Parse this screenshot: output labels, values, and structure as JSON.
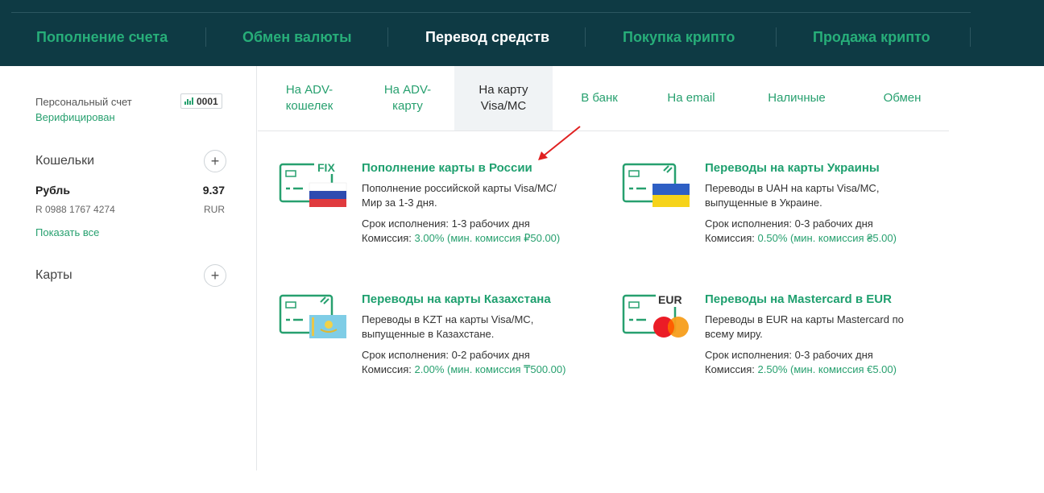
{
  "topnav": {
    "items": [
      {
        "label": "Пополнение счета",
        "active": false
      },
      {
        "label": "Обмен валюты",
        "active": false
      },
      {
        "label": "Перевод средств",
        "active": true
      },
      {
        "label": "Покупка крипто",
        "active": false
      },
      {
        "label": "Продажа крипто",
        "active": false
      }
    ]
  },
  "account": {
    "label": "Персональный счет",
    "status": "Верифицирован",
    "badge": "0001"
  },
  "wallets": {
    "title": "Кошельки",
    "add_label": "+",
    "items": [
      {
        "name": "Рубль",
        "balance": "9.37",
        "number": "R 0988 1767 4274",
        "currency": "RUR"
      }
    ],
    "show_all": "Показать все"
  },
  "cards": {
    "title": "Карты",
    "add_label": "+"
  },
  "subtabs": [
    {
      "label": "На ADV-\nкошелек",
      "active": false
    },
    {
      "label": "На ADV-\nкарту",
      "active": false
    },
    {
      "label": "На карту\nVisa/MC",
      "active": true
    },
    {
      "label": "В банк",
      "active": false
    },
    {
      "label": "На email",
      "active": false
    },
    {
      "label": "Наличные",
      "active": false
    },
    {
      "label": "Обмен",
      "active": false
    }
  ],
  "services": [
    {
      "title": "Пополнение карты в России",
      "description": "Пополнение российской карты Visa/MC/Мир за 1-3 дня.",
      "term": "Срок исполнения: 1-3 рабочих дня",
      "fee_label": "Комиссия: ",
      "fee_value": "3.00% (мин. комиссия ₽50.00)",
      "icon": "card-russia-flag-icon",
      "icon_tag": "FIX"
    },
    {
      "title": "Переводы на карты Украины",
      "description": "Переводы в UAH на карты Visa/MC, выпущенные в Украине.",
      "term": "Срок исполнения: 0-3 рабочих дня",
      "fee_label": "Комиссия: ",
      "fee_value": "0.50% (мин. комиссия ₴5.00)",
      "icon": "card-ukraine-flag-icon",
      "icon_tag": ""
    },
    {
      "title": "Переводы на карты Казахстана",
      "description": "Переводы в KZT на карты Visa/MC, выпущенные в Казахстане.",
      "term": "Срок исполнения: 0-2 рабочих дня",
      "fee_label": "Комиссия: ",
      "fee_value": "2.00% (мин. комиссия ₸500.00)",
      "icon": "card-kazakhstan-flag-icon",
      "icon_tag": ""
    },
    {
      "title": "Переводы на Mastercard в EUR",
      "description": "Переводы в EUR на карты Mastercard по всему миру.",
      "term": "Срок исполнения: 0-3 рабочих дня",
      "fee_label": "Комиссия: ",
      "fee_value": "2.50% (мин. комиссия €5.00)",
      "icon": "card-mastercard-eur-icon",
      "icon_tag": "EUR"
    }
  ],
  "colors": {
    "nav_bg": "#0e3a44",
    "accent": "#27a06f",
    "active_tab_bg": "#f0f3f5",
    "arrow": "#e02020"
  }
}
